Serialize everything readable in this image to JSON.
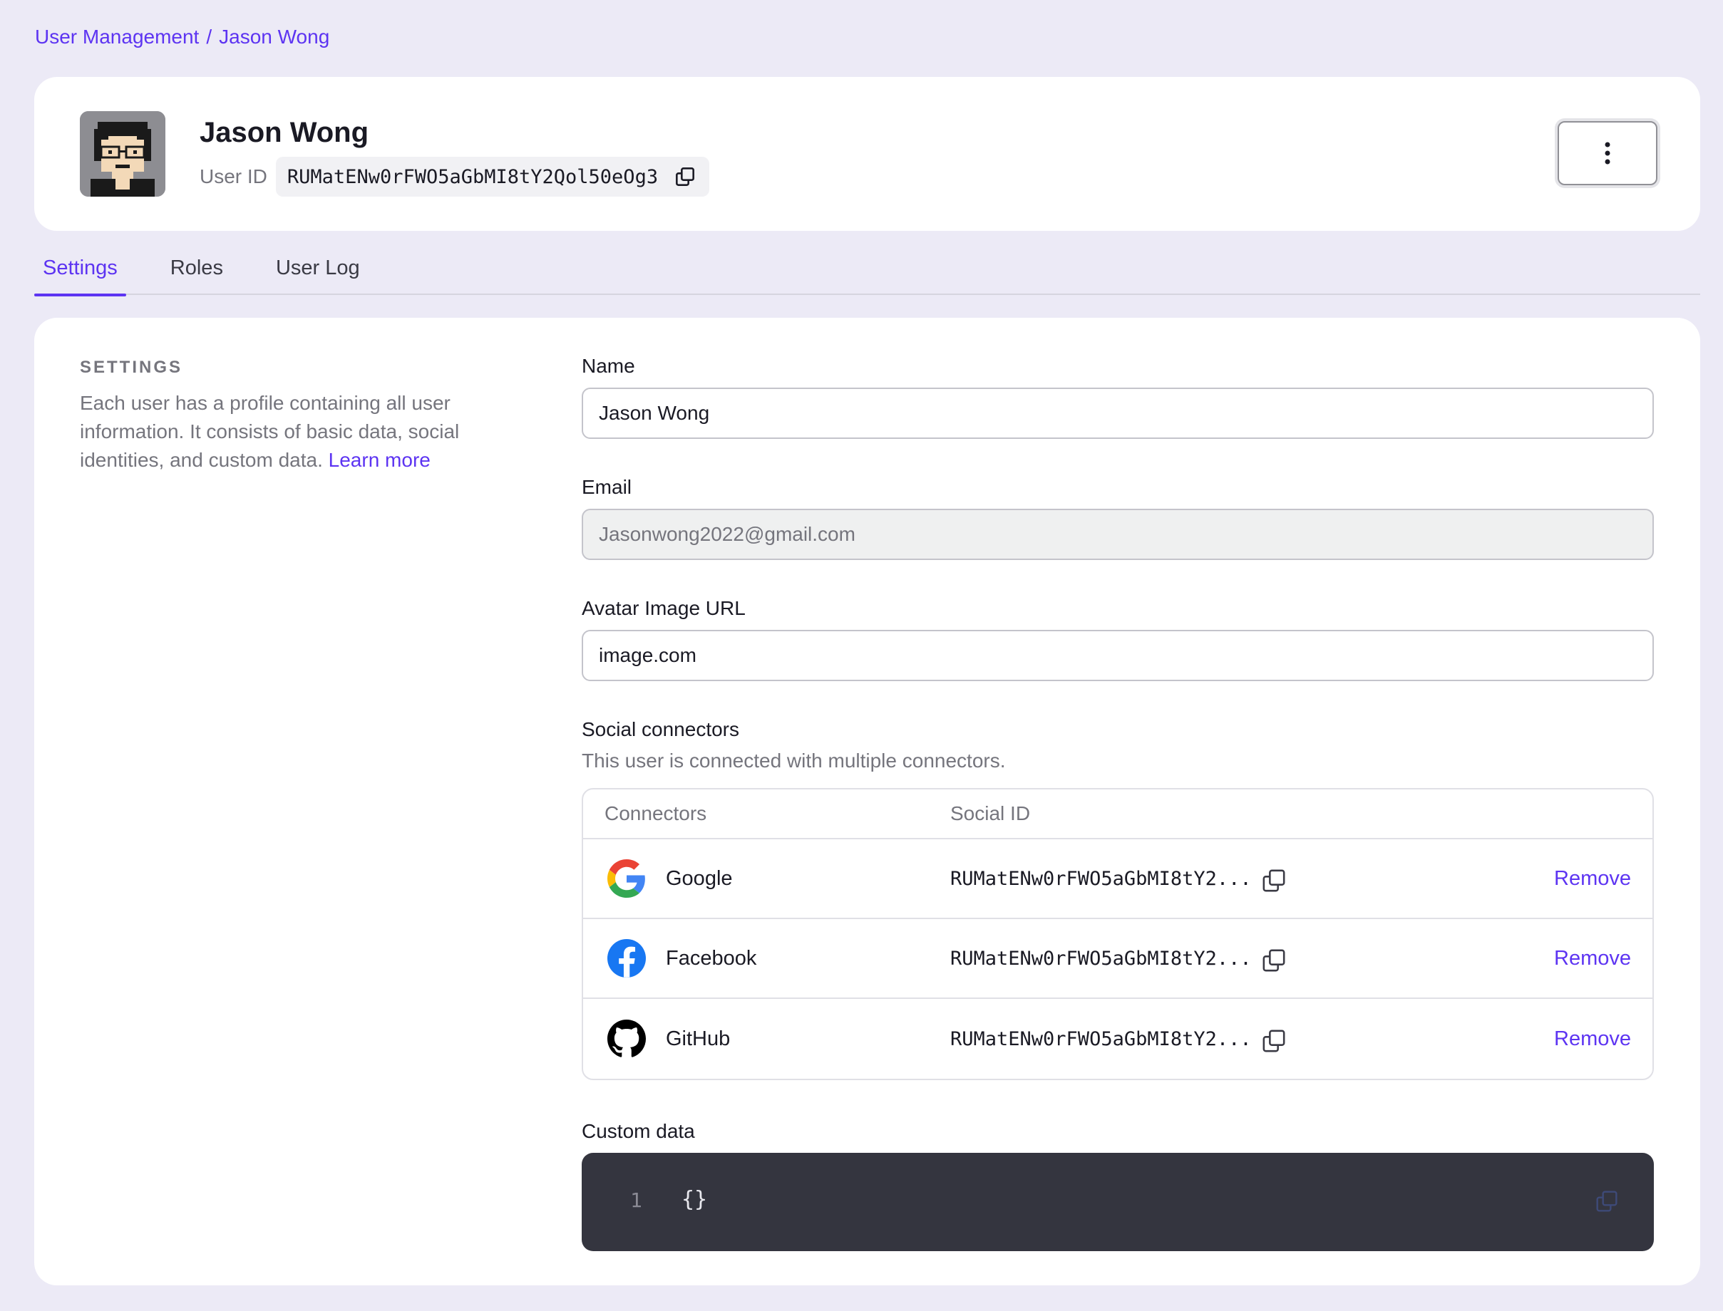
{
  "breadcrumb": {
    "parent": "User Management",
    "separator": "/",
    "current": "Jason Wong"
  },
  "user": {
    "name": "Jason Wong",
    "id_label": "User ID",
    "id_value": "RUMatENw0rFWO5aGbMI8tY2Qol50eOg3",
    "avatar_icon": "avatar-pixel-icon"
  },
  "tabs": [
    {
      "label": "Settings",
      "active": true
    },
    {
      "label": "Roles",
      "active": false
    },
    {
      "label": "User Log",
      "active": false
    }
  ],
  "settings": {
    "title": "SETTINGS",
    "description": "Each user has a profile containing all user information. It consists of basic data, social identities, and custom data.",
    "learn_more": "Learn more"
  },
  "form": {
    "name_label": "Name",
    "name_value": "Jason Wong",
    "email_label": "Email",
    "email_value": "Jasonwong2022@gmail.com",
    "avatar_label": "Avatar Image URL",
    "avatar_value": "image.com",
    "social_label": "Social connectors",
    "social_desc": "This user is connected with multiple connectors.",
    "col_connectors": "Connectors",
    "col_social_id": "Social ID",
    "connectors": [
      {
        "name": "Google",
        "social_id": "RUMatENw0rFWO5aGbMI8tY2...",
        "action": "Remove",
        "icon": "google-icon"
      },
      {
        "name": "Facebook",
        "social_id": "RUMatENw0rFWO5aGbMI8tY2...",
        "action": "Remove",
        "icon": "facebook-icon"
      },
      {
        "name": "GitHub",
        "social_id": "RUMatENw0rFWO5aGbMI8tY2...",
        "action": "Remove",
        "icon": "github-icon"
      }
    ],
    "custom_label": "Custom data",
    "custom_line_no": "1",
    "custom_code": "{}"
  },
  "colors": {
    "accent": "#5D34F2",
    "background": "#ECEAF6",
    "code_bg": "#34353F"
  }
}
